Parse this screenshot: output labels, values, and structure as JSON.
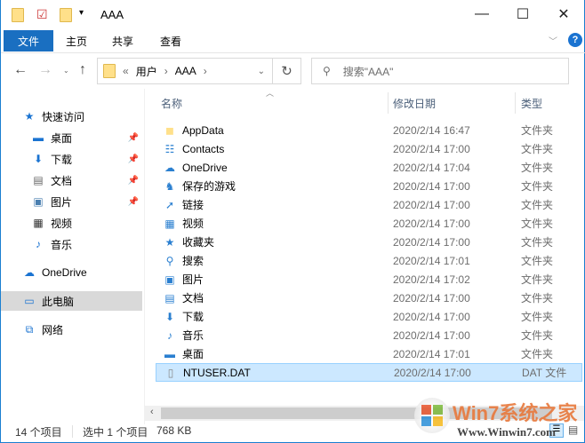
{
  "window": {
    "title": "AAA",
    "minimize": "—",
    "maximize": "☐",
    "close": "✕"
  },
  "ribbon": {
    "tabs": [
      "文件",
      "主页",
      "共享",
      "查看"
    ],
    "help": "?"
  },
  "address": {
    "crumbs": [
      "«",
      "用户",
      "›",
      "AAA",
      "›"
    ],
    "refresh": "↻",
    "search_placeholder": "搜索\"AAA\""
  },
  "nav": {
    "items": [
      {
        "label": "快速访问",
        "icon": "star-icon",
        "pinned": false
      },
      {
        "label": "桌面",
        "icon": "desktop-icon",
        "pinned": true
      },
      {
        "label": "下载",
        "icon": "download-icon",
        "pinned": true
      },
      {
        "label": "文档",
        "icon": "document-icon",
        "pinned": true
      },
      {
        "label": "图片",
        "icon": "picture-icon",
        "pinned": true
      },
      {
        "label": "视频",
        "icon": "video-icon",
        "pinned": false
      },
      {
        "label": "音乐",
        "icon": "music-icon",
        "pinned": false
      },
      {
        "label": "OneDrive",
        "icon": "cloud-icon",
        "pinned": false
      },
      {
        "label": "此电脑",
        "icon": "computer-icon",
        "pinned": false
      },
      {
        "label": "网络",
        "icon": "network-icon",
        "pinned": false
      }
    ]
  },
  "columns": {
    "name": "名称",
    "date": "修改日期",
    "type": "类型"
  },
  "files": [
    {
      "name": "AppData",
      "date": "2020/2/14 16:47",
      "type": "文件夹",
      "icon": "◼"
    },
    {
      "name": "Contacts",
      "date": "2020/2/14 17:00",
      "type": "文件夹",
      "icon": "☷"
    },
    {
      "name": "OneDrive",
      "date": "2020/2/14 17:04",
      "type": "文件夹",
      "icon": "☁"
    },
    {
      "name": "保存的游戏",
      "date": "2020/2/14 17:00",
      "type": "文件夹",
      "icon": "♞"
    },
    {
      "name": "链接",
      "date": "2020/2/14 17:00",
      "type": "文件夹",
      "icon": "➚"
    },
    {
      "name": "视频",
      "date": "2020/2/14 17:00",
      "type": "文件夹",
      "icon": "▦"
    },
    {
      "name": "收藏夹",
      "date": "2020/2/14 17:00",
      "type": "文件夹",
      "icon": "★"
    },
    {
      "name": "搜索",
      "date": "2020/2/14 17:01",
      "type": "文件夹",
      "icon": "⚲"
    },
    {
      "name": "图片",
      "date": "2020/2/14 17:02",
      "type": "文件夹",
      "icon": "▣"
    },
    {
      "name": "文档",
      "date": "2020/2/14 17:00",
      "type": "文件夹",
      "icon": "▤"
    },
    {
      "name": "下载",
      "date": "2020/2/14 17:00",
      "type": "文件夹",
      "icon": "⬇"
    },
    {
      "name": "音乐",
      "date": "2020/2/14 17:00",
      "type": "文件夹",
      "icon": "♪"
    },
    {
      "name": "桌面",
      "date": "2020/2/14 17:01",
      "type": "文件夹",
      "icon": "▬"
    },
    {
      "name": "NTUSER.DAT",
      "date": "2020/2/14 17:00",
      "type": "DAT 文件",
      "icon": "▯"
    }
  ],
  "status": {
    "count": "14 个项目",
    "selected": "选中 1 个项目",
    "size": "768 KB"
  },
  "watermark": {
    "brand": "Win7系统之家",
    "url": "Www.Winwin7.com"
  }
}
